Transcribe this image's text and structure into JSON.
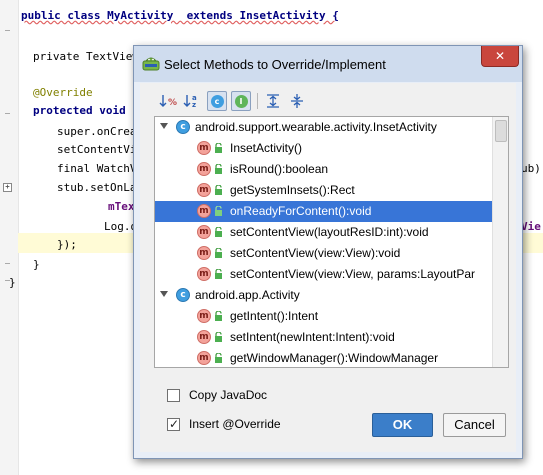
{
  "editor": {
    "lines": [
      "public class MyActivity  extends InsetActivity {",
      "private TextView",
      "@Override",
      "protected void",
      "super.onCrea",
      "setContentVie",
      "final WatchV",
      "stub.setOnLay",
      "mTex",
      "Log.d",
      "});",
      "}",
      "}"
    ],
    "right_fragments": [
      "ub);",
      "Vie"
    ]
  },
  "dialog": {
    "title": "Select Methods to Override/Implement",
    "close_label": "✕",
    "toolbar": {
      "sort_visibility_icon": "sort-by-visibility-icon",
      "sort_alpha_label": "↓a z",
      "show_classes_label": "c",
      "show_interfaces_label": "I",
      "expand_all_icon": "expand-all-icon",
      "collapse_all_icon": "collapse-all-icon"
    },
    "tree": {
      "groups": [
        {
          "name": "android.support.wearable.activity.InsetActivity",
          "methods": [
            "InsetActivity()",
            "isRound():boolean",
            "getSystemInsets():Rect",
            "onReadyForContent():void",
            "setContentView(layoutResID:int):void",
            "setContentView(view:View):void",
            "setContentView(view:View, params:LayoutPar"
          ]
        },
        {
          "name": "android.app.Activity",
          "methods": [
            "getIntent():Intent",
            "setIntent(newIntent:Intent):void",
            "getWindowManager():WindowManager"
          ]
        }
      ],
      "selected_method": "onReadyForContent():void",
      "class_icon_glyph": "c",
      "method_icon_glyph": "m"
    },
    "options": {
      "copy_javadoc_label": "Copy JavaDoc",
      "copy_javadoc_checked": false,
      "insert_override_label": "Insert @Override",
      "insert_override_checked": true,
      "check_glyph": "✓"
    },
    "buttons": {
      "ok_label": "OK",
      "cancel_label": "Cancel"
    }
  }
}
